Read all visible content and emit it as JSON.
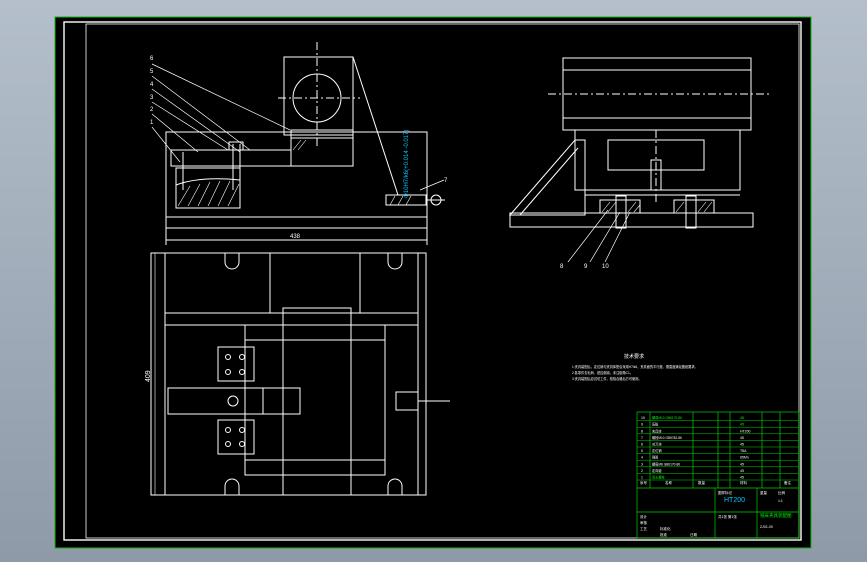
{
  "colors": {
    "background": "#a3aebb",
    "sheet": "#000000",
    "border": "#ffffff",
    "frame": "#14b414",
    "titleblock": "#00d000",
    "cyan": "#00c8ff",
    "green_text": "#00ff00"
  },
  "callouts": [
    "6",
    "5",
    "4",
    "3",
    "2",
    "1",
    "7",
    "8",
    "9",
    "10"
  ],
  "dimensions": {
    "width": "438",
    "height": "409",
    "tolerance": "Φ10H7/k6(+0.014 -0.017)"
  },
  "notes": {
    "title": "技术要求",
    "lines": [
      "1.夹具装配后，定位销与夹具体配合采用H7/k6，夹具面的平行度、垂直度满足图纸要求。",
      "2.各零件去毛刺、锐边倒钝，未注倒角C1。",
      "3.夹具装配后应试切工件，检验合格后方可使用。"
    ]
  },
  "titleblock": {
    "material": "HT200",
    "drawing_name": "铣床夹具装配图",
    "drawing_no": "ZJ01-00",
    "sheet_no": "共1张 第1张",
    "bom_left": [
      {
        "no": "10",
        "name": "螺母M10 GB6170-86"
      },
      {
        "no": "9",
        "name": "压板"
      },
      {
        "no": "8",
        "name": "夹具体"
      },
      {
        "no": "7",
        "name": "螺栓M10 GB5782-86"
      },
      {
        "no": "6",
        "name": "对刀块"
      },
      {
        "no": "5",
        "name": "定位销"
      },
      {
        "no": "4",
        "name": "弹簧"
      },
      {
        "no": "3",
        "name": "螺母M8 GB6170-86"
      },
      {
        "no": "2",
        "name": "定向键"
      },
      {
        "no": "1",
        "name": "双头螺柱"
      }
    ],
    "bom_header_left": "序号",
    "bom_header_mid": "名称",
    "bom_header_qty": "数量",
    "bom_header_mat": "材料",
    "bom_header_note": "备注",
    "bom_right": [
      "45",
      "45",
      "HT200",
      "45",
      "45",
      "T8A",
      "65Mn",
      "45",
      "45",
      "45"
    ],
    "labels_bottom": [
      "设计",
      "审核",
      "工艺",
      "标准化",
      "批准",
      "日期"
    ],
    "labels_right": [
      "图样标记",
      "重量",
      "比例",
      "1:1"
    ]
  }
}
